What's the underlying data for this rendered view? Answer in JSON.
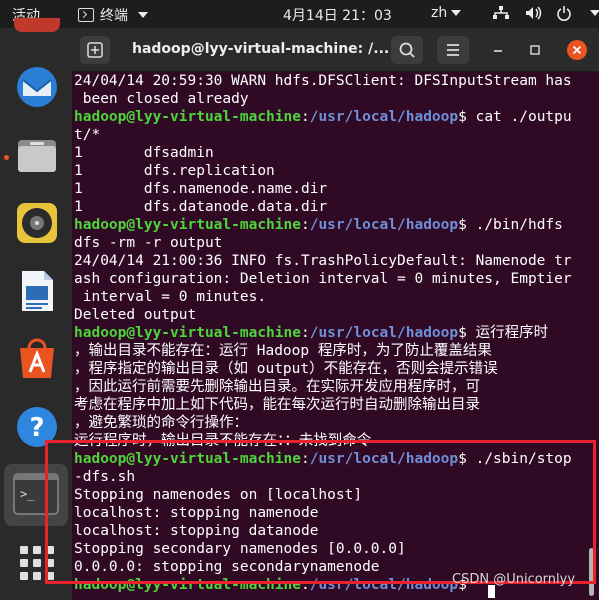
{
  "topbar": {
    "activities": "活动",
    "app_name": "终端",
    "clock": "4月14日 21：03",
    "ime": "zh",
    "icons": [
      "network-icon",
      "volume-icon",
      "power-icon"
    ]
  },
  "dock": {
    "apps": [
      "thunderbird-icon",
      "files-icon",
      "rhythmbox-icon",
      "libreoffice-writer-icon",
      "ubuntu-software-icon",
      "help-icon",
      "terminal-icon",
      "show-apps-icon"
    ]
  },
  "window": {
    "title": "hadoop@lyy-virtual-machine: /...",
    "accent": "#e95420"
  },
  "terminal": {
    "colors": {
      "user": "#4ed53a",
      "path": "#6f8fd8",
      "text": "#ffffff",
      "bg": "#300a24"
    },
    "lines": [
      [
        {
          "t": "24/04/14 20:59:30 WARN hdfs.DFSClient: DFSInputStream has",
          "c": ""
        }
      ],
      [
        {
          "t": " been closed already",
          "c": ""
        }
      ],
      [
        {
          "t": "hadoop@lyy-virtual-machine",
          "c": "u"
        },
        {
          "t": ":",
          "c": ""
        },
        {
          "t": "/usr/local/hadoop",
          "c": "p"
        },
        {
          "t": "$ cat ./outpu",
          "c": ""
        }
      ],
      [
        {
          "t": "t/*",
          "c": ""
        }
      ],
      [
        {
          "t": "1       dfsadmin",
          "c": ""
        }
      ],
      [
        {
          "t": "1       dfs.replication",
          "c": ""
        }
      ],
      [
        {
          "t": "1       dfs.namenode.name.dir",
          "c": ""
        }
      ],
      [
        {
          "t": "1       dfs.datanode.data.dir",
          "c": ""
        }
      ],
      [
        {
          "t": "hadoop@lyy-virtual-machine",
          "c": "u"
        },
        {
          "t": ":",
          "c": ""
        },
        {
          "t": "/usr/local/hadoop",
          "c": "p"
        },
        {
          "t": "$ ./bin/hdfs",
          "c": ""
        }
      ],
      [
        {
          "t": "dfs -rm -r output",
          "c": ""
        }
      ],
      [
        {
          "t": "24/04/14 21:00:36 INFO fs.TrashPolicyDefault: Namenode tr",
          "c": ""
        }
      ],
      [
        {
          "t": "ash configuration: Deletion interval = 0 minutes, Emptier",
          "c": ""
        }
      ],
      [
        {
          "t": " interval = 0 minutes.",
          "c": ""
        }
      ],
      [
        {
          "t": "Deleted output",
          "c": ""
        }
      ],
      [
        {
          "t": "hadoop@lyy-virtual-machine",
          "c": "u"
        },
        {
          "t": ":",
          "c": ""
        },
        {
          "t": "/usr/local/hadoop",
          "c": "p"
        },
        {
          "t": "$ 运行程序时",
          "c": ""
        }
      ],
      [
        {
          "t": "，输出目录不能存在：运行 Hadoop 程序时，为了防止覆盖结果",
          "c": ""
        }
      ],
      [
        {
          "t": "，程序指定的输出目录（如 output）不能存在，否则会提示错误",
          "c": ""
        }
      ],
      [
        {
          "t": "，因此运行前需要先删除输出目录。在实际开发应用程序时，可",
          "c": ""
        }
      ],
      [
        {
          "t": "考虑在程序中加上如下代码，能在每次运行时自动删除输出目录",
          "c": ""
        }
      ],
      [
        {
          "t": "，避免繁琐的命令行操作：",
          "c": ""
        }
      ],
      [
        {
          "t": "运行程序时，输出目录不能存在：：未找到命令",
          "c": ""
        }
      ],
      [
        {
          "t": "hadoop@lyy-virtual-machine",
          "c": "u"
        },
        {
          "t": ":",
          "c": ""
        },
        {
          "t": "/usr/local/hadoop",
          "c": "p"
        },
        {
          "t": "$ ./sbin/stop",
          "c": ""
        }
      ],
      [
        {
          "t": "-dfs.sh",
          "c": ""
        }
      ],
      [
        {
          "t": "Stopping namenodes on [localhost]",
          "c": ""
        }
      ],
      [
        {
          "t": "localhost: stopping namenode",
          "c": ""
        }
      ],
      [
        {
          "t": "localhost: stopping datanode",
          "c": ""
        }
      ],
      [
        {
          "t": "Stopping secondary namenodes [0.0.0.0]",
          "c": ""
        }
      ],
      [
        {
          "t": "0.0.0.0: stopping secondarynamenode",
          "c": ""
        }
      ],
      [
        {
          "t": "hadoop@lyy-virtual-machine",
          "c": "u"
        },
        {
          "t": ":",
          "c": ""
        },
        {
          "t": "/usr/local/hadoop",
          "c": "p"
        },
        {
          "t": "$ ",
          "c": ""
        }
      ]
    ]
  },
  "watermark": "CSDN @Unicornlyy",
  "highlight_color": "#e8232b"
}
